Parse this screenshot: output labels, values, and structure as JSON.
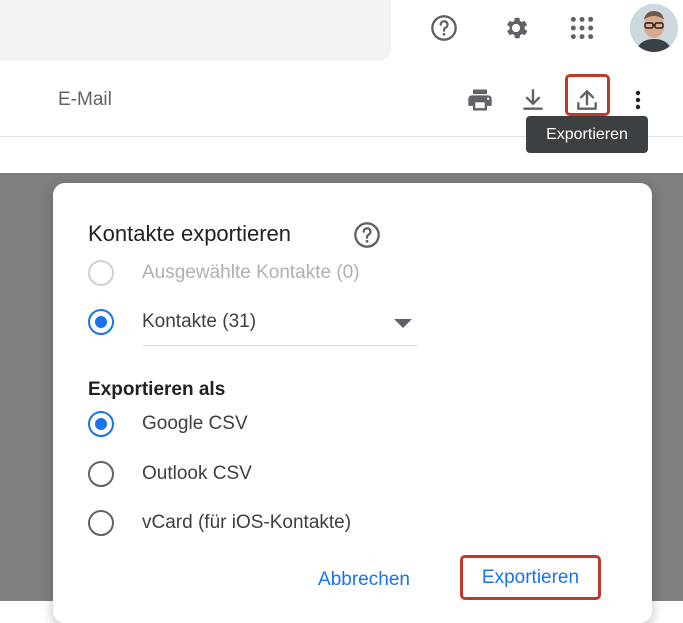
{
  "header": {
    "help_icon": "help-circle-icon",
    "settings_icon": "gear-icon",
    "apps_icon": "apps-grid-icon",
    "avatar_icon": "user-avatar"
  },
  "toolbar": {
    "column_label": "E-Mail",
    "print_icon": "printer-icon",
    "import_icon": "download-icon",
    "export_icon": "upload-icon",
    "more_icon": "more-vertical-icon",
    "tooltip": "Exportieren"
  },
  "dialog": {
    "title": "Kontakte exportieren",
    "options": [
      {
        "label": "Ausgewählte Kontakte (0)",
        "checked": false,
        "disabled": true
      },
      {
        "label": "Kontakte (31)",
        "checked": true,
        "disabled": false
      }
    ],
    "export_as_label": "Exportieren als",
    "formats": [
      {
        "label": "Google CSV",
        "checked": true
      },
      {
        "label": "Outlook CSV",
        "checked": false
      },
      {
        "label": "vCard (für iOS-Kontakte)",
        "checked": false
      }
    ],
    "cancel_label": "Abbrechen",
    "export_label": "Exportieren"
  },
  "colors": {
    "accent": "#1a73e8",
    "highlight": "#c0392b",
    "overlay": "#7f7f7f"
  }
}
